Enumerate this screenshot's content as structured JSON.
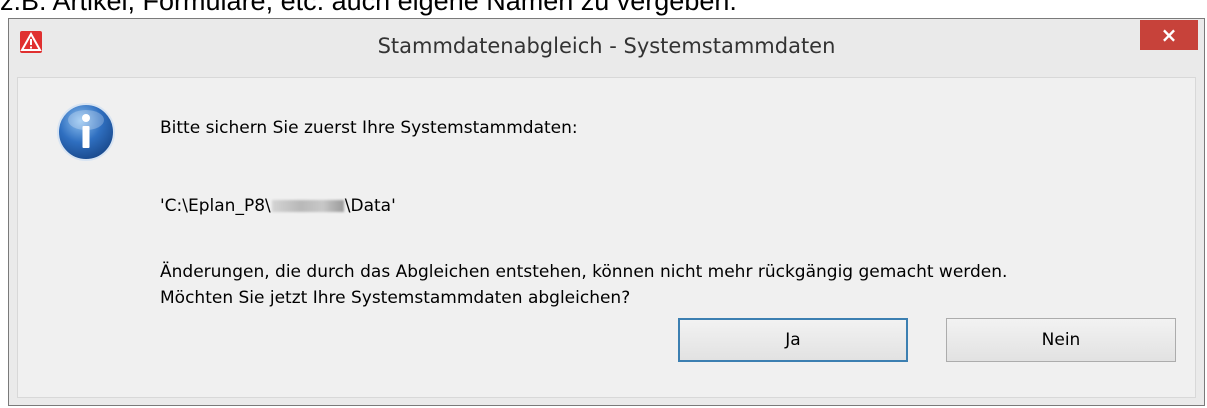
{
  "document": {
    "text": "z.B. Artikel, Formulare, etc. auch eigene Namen zu vergeben."
  },
  "dialog": {
    "title": "Stammdatenabgleich - Systemstammdaten",
    "close_label": "×",
    "message_line1": "Bitte sichern Sie zuerst Ihre Systemstammdaten:",
    "path_prefix": "'C:\\Eplan_P8\\",
    "path_suffix": "\\Data'",
    "message_line3": "Änderungen, die durch das Abgleichen entstehen, können nicht mehr rückgängig gemacht werden.",
    "message_line4": "Möchten Sie jetzt Ihre Systemstammdaten abgleichen?",
    "yes_label": "Ja",
    "no_label": "Nein"
  },
  "icons": {
    "app": "warning-triangle-icon",
    "info": "info-icon",
    "close": "close-icon"
  },
  "colors": {
    "close_button": "#c7423a",
    "default_button_border": "#3c7fb1",
    "info_icon": "#2f6fc0",
    "app_icon": "#e03030"
  }
}
